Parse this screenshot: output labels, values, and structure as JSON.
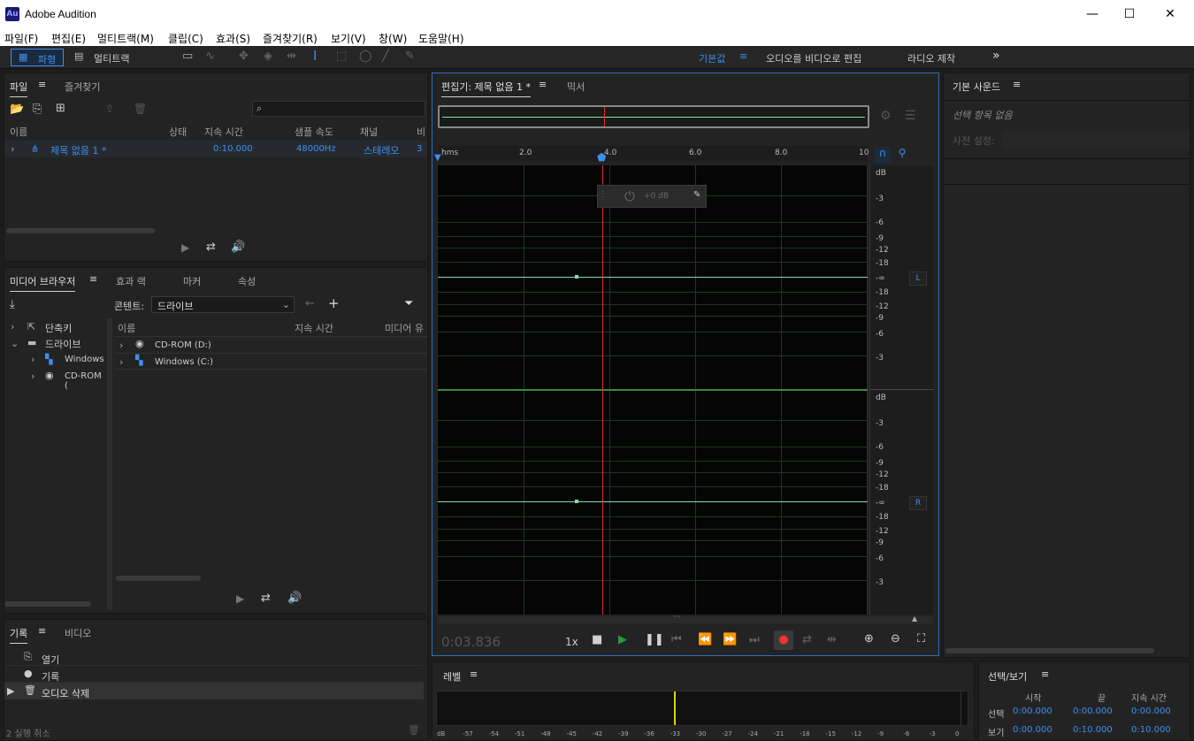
{
  "app": {
    "title": "Adobe Audition",
    "logo": "Au"
  },
  "menu": [
    "파일(F)",
    "편집(E)",
    "멀티트랙(M)",
    "클립(C)",
    "효과(S)",
    "즐겨찾기(R)",
    "보기(V)",
    "창(W)",
    "도움말(H)"
  ],
  "toolbar": {
    "waveform": "파형",
    "multitrack": "멀티트랙",
    "workspaces": [
      "기본값",
      "오디오를 비디오로 편집",
      "라디오 제작"
    ],
    "more": "»"
  },
  "files": {
    "tabs": [
      "파일",
      "즐겨찾기"
    ],
    "columns": [
      "이름",
      "상태",
      "지속 시간",
      "샘플 속도",
      "채널",
      "비"
    ],
    "rows": [
      {
        "name": "제목 없음 1 *",
        "duration": "0:10.000",
        "rate": "48000Hz",
        "channels": "스테레오",
        "extra": "3"
      }
    ]
  },
  "media": {
    "tabs": [
      "미디어 브라우저",
      "효과 랙",
      "마커",
      "속성"
    ],
    "content_label": "콘텐트:",
    "content_value": "드라이브",
    "tree": [
      {
        "label": "단축키"
      },
      {
        "label": "드라이브"
      },
      {
        "label": "Windows"
      },
      {
        "label": "CD-ROM ("
      }
    ],
    "columns": [
      "이름",
      "지속 시간",
      "미디어 유"
    ],
    "rows": [
      "CD-ROM (D:)",
      "Windows (C:)"
    ]
  },
  "history": {
    "tabs": [
      "기록",
      "비디오"
    ],
    "items": [
      "열기",
      "기록",
      "오디오 삭제"
    ],
    "status": "2 실행 취소"
  },
  "editor": {
    "tabs": [
      "편집기: 제목 없음 1 *",
      "믹서"
    ],
    "ruler_unit": "hms",
    "ruler": [
      "2.0",
      "4.0",
      "6.0",
      "8.0",
      "10"
    ],
    "hud": "+0 dB",
    "db_top": [
      "dB",
      "-3",
      "-6",
      "-9",
      "-12",
      "-18",
      "-∞",
      "-18",
      "-12",
      "-9",
      "-6",
      "-3"
    ],
    "db_bottom": [
      "dB",
      "-3",
      "-6",
      "-9",
      "-12",
      "-18",
      "-∞",
      "-18",
      "-12",
      "-9",
      "-6",
      "-3"
    ],
    "ch_left": "L",
    "ch_right": "R",
    "time": "0:03.836",
    "speed": "1x",
    "playhead_seconds": 3.836,
    "total_seconds": 10
  },
  "essential": {
    "title": "기본 사운드",
    "nosel": "선택 항목 없음",
    "preset": "사전 설정:"
  },
  "levels": {
    "title": "레벨",
    "scale": [
      "dB",
      "-57",
      "-54",
      "-51",
      "-48",
      "-45",
      "-42",
      "-39",
      "-36",
      "-33",
      "-30",
      "-27",
      "-24",
      "-21",
      "-18",
      "-15",
      "-12",
      "-9",
      "-6",
      "-3",
      "0"
    ]
  },
  "selview": {
    "title": "선택/보기",
    "cols": [
      "시작",
      "끝",
      "지속 시간"
    ],
    "rows": [
      {
        "label": "선택",
        "start": "0:00.000",
        "end": "0:00.000",
        "dur": "0:00.000"
      },
      {
        "label": "보기",
        "start": "0:00.000",
        "end": "0:10.000",
        "dur": "0:10.000"
      }
    ]
  },
  "colors": {
    "accent": "#3f8ff0",
    "wave": "#7fe0a8",
    "playhead": "#e03030",
    "panel_border": "#2d6fb8"
  }
}
